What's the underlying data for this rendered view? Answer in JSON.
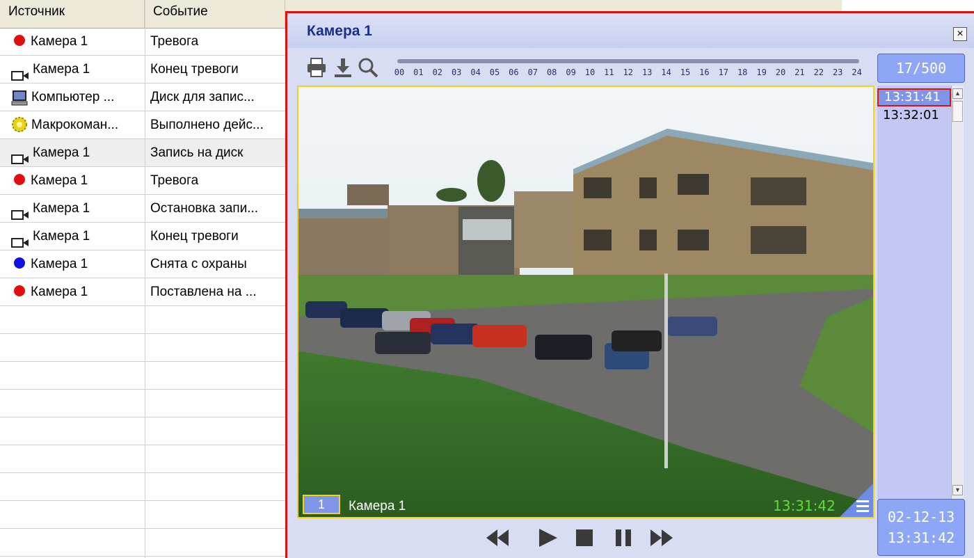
{
  "log": {
    "columns": [
      "Источник",
      "Событие"
    ],
    "rows": [
      {
        "icon": "red-dot-icon",
        "source": "Камера 1",
        "event": "Тревога"
      },
      {
        "icon": "camera-icon",
        "source": "Камера 1",
        "event": "Конец тревоги"
      },
      {
        "icon": "computer-icon",
        "source": "Компьютер ...",
        "event": "Диск для запис..."
      },
      {
        "icon": "macro-gear-icon",
        "source": "Макрокоман...",
        "event": "Выполнено дейс..."
      },
      {
        "icon": "camera-icon",
        "source": "Камера 1",
        "event": "Запись на диск"
      },
      {
        "icon": "red-dot-icon",
        "source": "Камера 1",
        "event": "Тревога"
      },
      {
        "icon": "camera-icon",
        "source": "Камера 1",
        "event": "Остановка запи..."
      },
      {
        "icon": "camera-icon",
        "source": "Камера 1",
        "event": "Конец тревоги"
      },
      {
        "icon": "blue-dot-icon",
        "source": "Камера 1",
        "event": "Снята с охраны"
      },
      {
        "icon": "red-dot-icon",
        "source": "Камера 1",
        "event": "Поставлена на ..."
      }
    ],
    "selected_row": 4
  },
  "camera": {
    "title": "Камера 1",
    "close_label": "×",
    "counter": "17/500",
    "timeline_hours": [
      "00",
      "01",
      "02",
      "03",
      "04",
      "05",
      "06",
      "07",
      "08",
      "09",
      "10",
      "11",
      "12",
      "13",
      "14",
      "15",
      "16",
      "17",
      "18",
      "19",
      "20",
      "21",
      "22",
      "23",
      "24"
    ],
    "video": {
      "camera_number": "1",
      "camera_label": "Камера 1",
      "osd_time": "13:31:42"
    },
    "time_list": [
      "13:31:41",
      "13:32:01"
    ],
    "selected_time": 0,
    "date": "02-12-13",
    "time": "13:31:42"
  },
  "colors": {
    "red": "#e01010",
    "blue": "#1010e0",
    "accent": "#8da6f5",
    "yellow_border": "#f2d21a"
  }
}
